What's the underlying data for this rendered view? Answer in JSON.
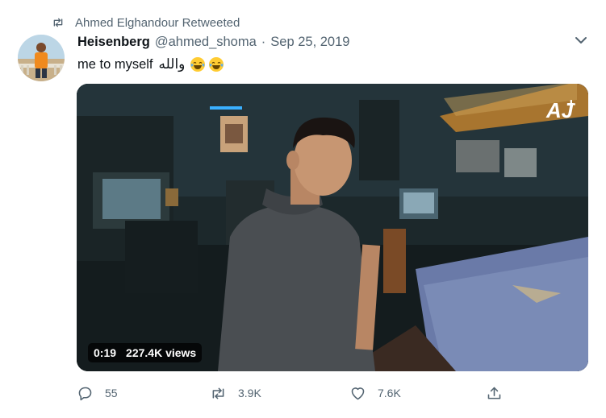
{
  "retweet_context": {
    "text": "Ahmed Elghandour Retweeted",
    "icon": "retweet-icon"
  },
  "tweet": {
    "author_name": "Heisenberg",
    "handle": "@ahmed_shoma",
    "separator": "·",
    "date": "Sep 25, 2019",
    "text": "me to myself",
    "text_arabic": "والله",
    "emojis": [
      "face-with-tears-of-joy",
      "face-with-tears-of-joy"
    ]
  },
  "media": {
    "kind": "video",
    "duration": "0:19",
    "views": "227.4K views",
    "watermark": "AJ+"
  },
  "actions": {
    "reply_count": "55",
    "retweet_count": "3.9K",
    "like_count": "7.6K"
  },
  "colors": {
    "text_primary": "#0f1419",
    "text_secondary": "#536471"
  }
}
